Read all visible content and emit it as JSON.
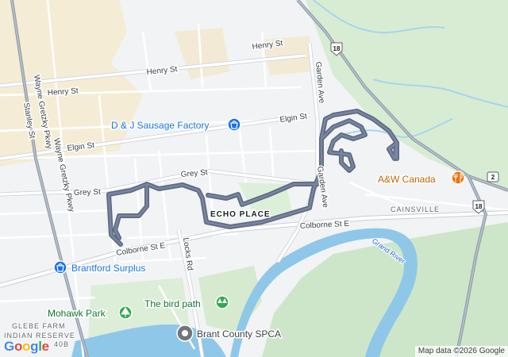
{
  "map": {
    "streets": {
      "henry_east": "Henry St",
      "henry_west": "Henry St",
      "elgin_east": "Elgin St",
      "elgin_west": "Elgin St",
      "grey_east": "Grey St",
      "grey_west": "Grey St",
      "colborne_west": "Colborne St E",
      "colborne_east": "Colborne St E",
      "stanley": "Stanley St",
      "wayne_gretzky_1": "Wayne Gretzky Pkwy",
      "wayne_gretzky_2": "Wayne Gretzky Pkwy",
      "garden_north": "Garden Ave",
      "garden_south": "Garden Ave",
      "locks": "Locks Rd"
    },
    "areas": {
      "echo_place": "ECHO PLACE",
      "cainsville": "CAINSVILLE",
      "glebe_farm": "GLEBE FARM",
      "indian_reserve": "INDIAN RESERVE",
      "reserve_number": "40B"
    },
    "water": {
      "grand_river": "Grand River"
    },
    "pois": {
      "dj": "D & J Sausage Factory",
      "aw": "A&W Canada",
      "brantford": "Brantford Surplus",
      "mohawk": "Mohawk Park",
      "bird": "The bird path",
      "spca": "Brant County SPCA"
    },
    "shields": {
      "hwy18_north": "18",
      "hwy18_east": "18",
      "hwy2": "2"
    },
    "route_color": "#5f6b84",
    "attribution": "Map data ©2026 Google",
    "logo": "Google"
  }
}
